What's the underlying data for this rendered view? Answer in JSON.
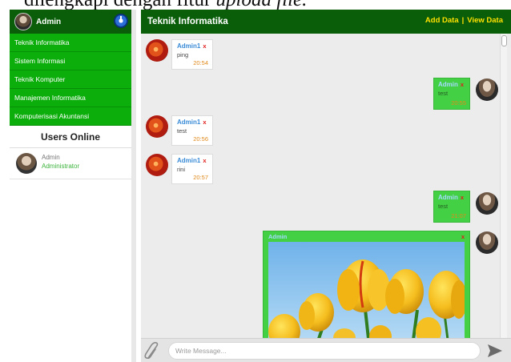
{
  "caption": {
    "text_main": "dilengkapi dengan fitur ",
    "text_italic": "upload file."
  },
  "sidebar": {
    "user_name": "Admin",
    "menu": [
      {
        "label": "Teknik Informatika"
      },
      {
        "label": "Sistem Informasi"
      },
      {
        "label": "Teknik Komputer"
      },
      {
        "label": "Manajemen Informatika"
      },
      {
        "label": "Komputerisasi Akuntansi"
      }
    ],
    "online_title": "Users Online",
    "online_users": [
      {
        "name": "Admin",
        "role": "Administrator"
      }
    ]
  },
  "header": {
    "title": "Teknik Informatika",
    "add_label": "Add Data",
    "separator": "|",
    "view_label": "View Data"
  },
  "messages": [
    {
      "side": "left",
      "sender": "Admin1",
      "delete": "x",
      "text": "ping",
      "time": "20:54"
    },
    {
      "side": "right",
      "sender": "Admin",
      "delete": "x",
      "text": "test",
      "time": "20:55"
    },
    {
      "side": "left",
      "sender": "Admin1",
      "delete": "x",
      "text": "test",
      "time": "20:56"
    },
    {
      "side": "left",
      "sender": "Admin1",
      "delete": "x",
      "text": "rini",
      "time": "20:57"
    },
    {
      "side": "right",
      "sender": "Admin",
      "delete": "x",
      "text": "test",
      "time": "21:07"
    },
    {
      "side": "right",
      "sender": "Admin",
      "delete": "x",
      "attachment": "image"
    }
  ],
  "composer": {
    "placeholder": "Write Message..."
  },
  "icons": {
    "logout": "power-icon",
    "attach": "paperclip-icon",
    "send": "send-arrow-icon"
  },
  "colors": {
    "header_dark": "#0a5e0a",
    "menu_green": "#0cae0c",
    "bubble_green": "#44d044",
    "link_yellow": "#ffe100",
    "time_orange": "#e08a1c",
    "delete_red": "#e01b1b"
  }
}
